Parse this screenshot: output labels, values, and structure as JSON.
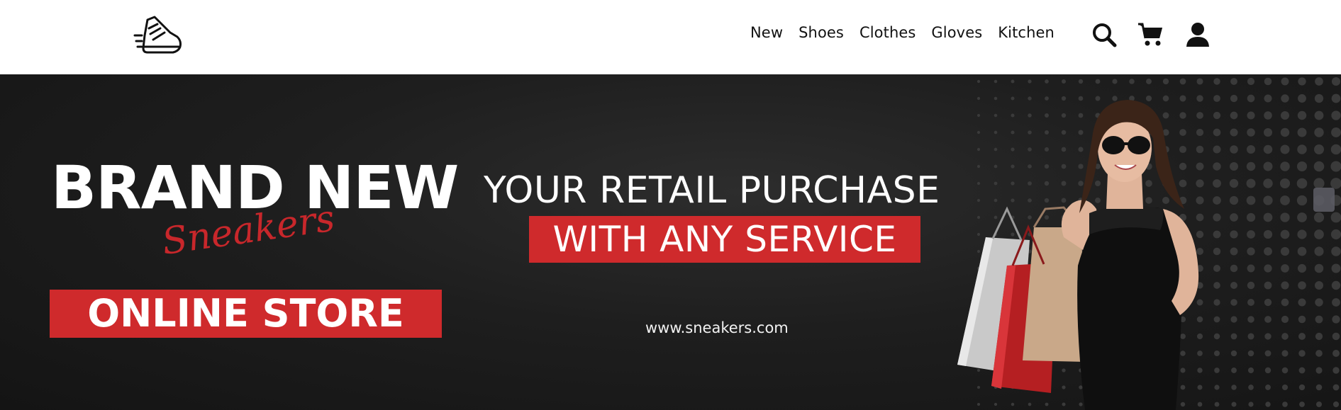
{
  "nav": {
    "logo": "sneaker-logo-icon",
    "links": [
      "New",
      "Shoes",
      "Clothes",
      "Gloves",
      "Kitchen"
    ],
    "icons": [
      "search-icon",
      "cart-icon",
      "user-icon"
    ]
  },
  "hero": {
    "headline": "BRAND NEW",
    "script": "Sneakers",
    "banner": "ONLINE STORE",
    "tagline_line1": "YOUR RETAIL PURCHASE",
    "tagline_line2": "WITH ANY SERVICE",
    "website": "www.sneakers.com",
    "accent_color": "#cf2a2c",
    "background_color": "#1c1c1c"
  }
}
